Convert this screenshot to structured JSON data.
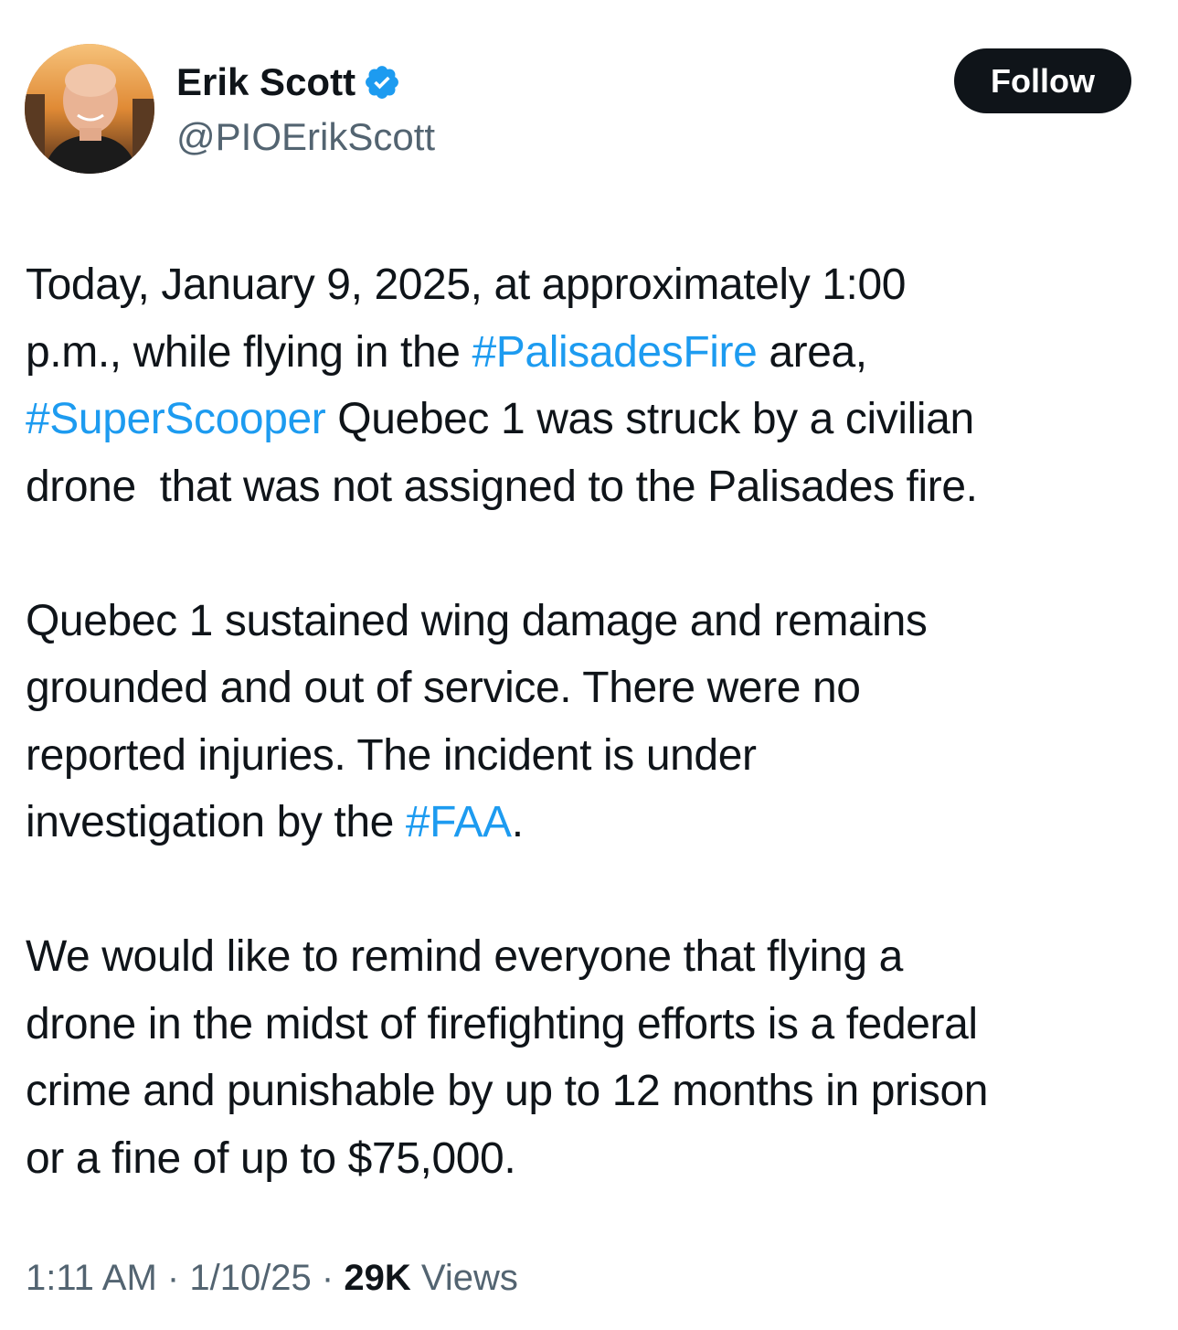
{
  "author": {
    "display_name": "Erik Scott",
    "handle": "@PIOErikScott",
    "verified_icon": "verified-badge-icon",
    "avatar": "profile-photo"
  },
  "follow_button": {
    "label": "Follow"
  },
  "tweet": {
    "paragraph1": {
      "l1": "Today, January 9, 2025, at approximately 1:00",
      "l2_a": "p.m., while flying in the ",
      "l2_tag": "#PalisadesFire",
      "l2_b": " area,",
      "l3_tag": "#SuperScooper",
      "l3_b": " Quebec 1 was struck by a civilian",
      "l4": "drone  that was not assigned to the Palisades fire."
    },
    "paragraph2": {
      "l1": "Quebec 1 sustained wing damage and remains",
      "l2": "grounded and out of service. There were no",
      "l3": "reported injuries. The incident is under",
      "l4_a": "investigation by the ",
      "l4_tag": "#FAA",
      "l4_b": "."
    },
    "paragraph3": {
      "l1": "We would like to remind everyone that flying a",
      "l2": "drone in the midst of firefighting efforts is a federal",
      "l3": "crime and punishable by up to 12 months in prison",
      "l4": "or a fine of up to $75,000."
    }
  },
  "meta": {
    "time": "1:11 AM",
    "separator": " · ",
    "date": "1/10/25",
    "views_count": "29K",
    "views_label": " Views"
  },
  "colors": {
    "text": "#0f1419",
    "secondary": "#536471",
    "link": "#1d9bf0",
    "button_bg": "#0f1419"
  }
}
